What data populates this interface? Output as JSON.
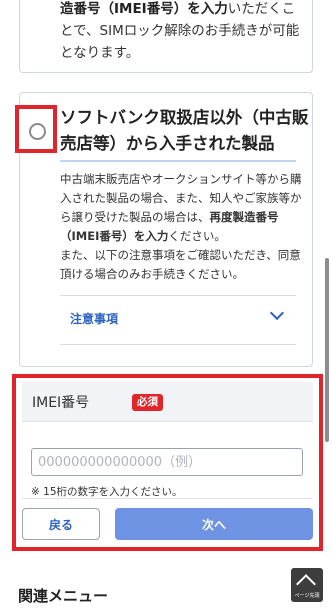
{
  "top_option": {
    "text_bold": "造番号（IMEI番号）を入力",
    "text_rest": "いただくことで、SIMロック解除のお手続きが可能となります。"
  },
  "option": {
    "title": "ソフトバンク取扱店以外（中古販売店等）から入手された製品",
    "desc_part1": "中古端末販売店やオークションサイト等から購入された製品の場合、また、知人やご家族等から譲り受けた製品の場合は、",
    "desc_bold": "再度製造番号（IMEI番号）を入力",
    "desc_part2": "ください。",
    "desc_part3": "また、以下の注意事項をご確認いただき、同意頂ける場合のみお手続きください。",
    "notes_label": "注意事項"
  },
  "imei": {
    "label": "IMEI番号",
    "required": "必須",
    "placeholder": "000000000000000（例）",
    "note": "※ 15桁の数字を入力ください。"
  },
  "buttons": {
    "back": "戻る",
    "next": "次へ"
  },
  "related_menu": "関連メニュー",
  "page_top": "ページ先頭",
  "colors": {
    "highlight": "#e0262a",
    "link": "#2c63c0",
    "primary_button": "#6f93e3"
  }
}
